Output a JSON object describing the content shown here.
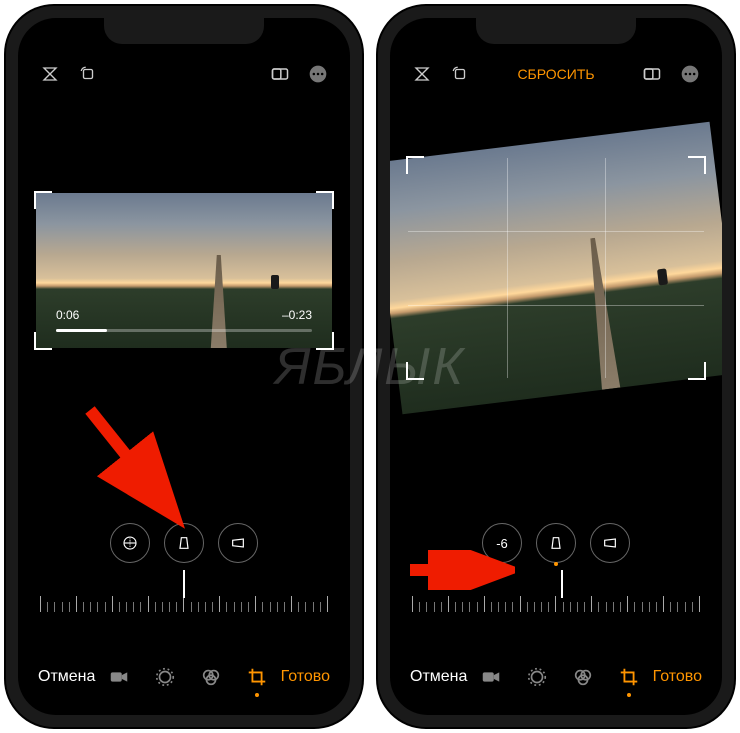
{
  "left": {
    "reset": null,
    "time_current": "0:06",
    "time_remaining": "–0:23",
    "adjust_value": "",
    "cancel": "Отмена",
    "done": "Готово"
  },
  "right": {
    "reset": "СБРОСИТЬ",
    "adjust_value": "-6",
    "cancel": "Отмена",
    "done": "Готово"
  },
  "icons": {
    "flip_v": "flip-vertical-icon",
    "rotate": "rotate-icon",
    "aspect": "aspect-ratio-icon",
    "more": "more-icon",
    "straighten": "straighten-icon",
    "flip_h": "flip-horizontal-icon",
    "perspective_h": "perspective-horizontal-icon",
    "video": "video-icon",
    "adjust": "adjust-icon",
    "filters": "filters-icon",
    "crop": "crop-icon"
  },
  "watermark": "ЯБЛЫК",
  "colors": {
    "accent": "#ff9500",
    "arrow": "#ef1c00"
  }
}
